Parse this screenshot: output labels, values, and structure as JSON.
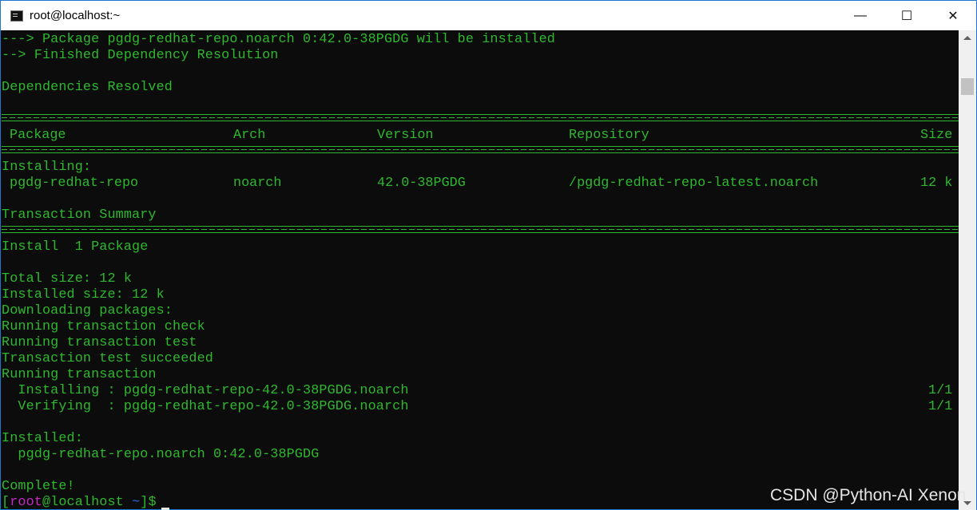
{
  "window": {
    "title": "root@localhost:~",
    "controls": {
      "minimize": "—",
      "maximize": "☐",
      "close": "✕"
    }
  },
  "terminal": {
    "lines_top": [
      "---> Package pgdg-redhat-repo.noarch 0:42.0-38PGDG will be installed",
      "--> Finished Dependency Resolution",
      "Dependencies Resolved"
    ],
    "table": {
      "headers": {
        "package": "Package",
        "arch": "Arch",
        "version": "Version",
        "repository": "Repository",
        "size": "Size"
      },
      "section": "Installing:",
      "row": {
        "package": "pgdg-redhat-repo",
        "arch": "noarch",
        "version": "42.0-38PGDG",
        "repository": "/pgdg-redhat-repo-latest.noarch",
        "size": "12 k"
      }
    },
    "summary_title": "Transaction Summary",
    "summary_line": "Install  1 Package",
    "lines_bottom": [
      "Total size: 12 k",
      "Installed size: 12 k",
      "Downloading packages:",
      "Running transaction check",
      "Running transaction test",
      "Transaction test succeeded",
      "Running transaction"
    ],
    "steps": [
      {
        "text": "  Installing : pgdg-redhat-repo-42.0-38PGDG.noarch",
        "count": "1/1"
      },
      {
        "text": "  Verifying  : pgdg-redhat-repo-42.0-38PGDG.noarch",
        "count": "1/1"
      }
    ],
    "installed_label": "Installed:",
    "installed_pkg": "  pgdg-redhat-repo.noarch 0:42.0-38PGDG",
    "complete": "Complete!",
    "prompt": {
      "open": "[",
      "user": "root",
      "at": "@localhost ",
      "dir": "~",
      "close": "]$"
    }
  },
  "watermark": "CSDN @Python-AI Xenon",
  "colors": {
    "text_green": "#2fb82f",
    "background": "#0c0c0c",
    "prompt_user": "#c22ac2",
    "prompt_dir": "#2f6bd6",
    "window_border": "#1c75d1"
  }
}
